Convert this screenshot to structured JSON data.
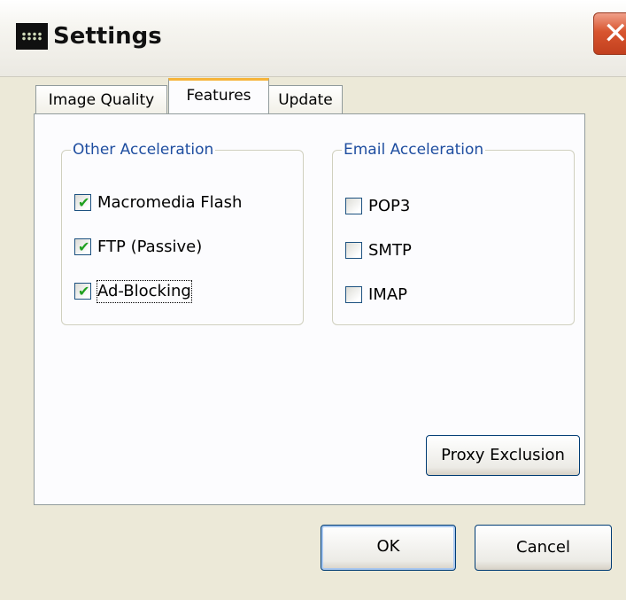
{
  "window": {
    "title": "Settings",
    "close_glyph": "✕"
  },
  "tabs": [
    {
      "label": "Image Quality",
      "active": false
    },
    {
      "label": "Features",
      "active": true
    },
    {
      "label": "Update",
      "active": false
    }
  ],
  "other_acceleration": {
    "legend": "Other Acceleration",
    "items": [
      {
        "label": "Macromedia Flash",
        "checked": true
      },
      {
        "label": "FTP (Passive)",
        "checked": true
      },
      {
        "label": "Ad-Blocking",
        "checked": true
      }
    ]
  },
  "email_acceleration": {
    "legend": "Email Acceleration",
    "items": [
      {
        "label": "POP3",
        "checked": false
      },
      {
        "label": "SMTP",
        "checked": false
      },
      {
        "label": "IMAP",
        "checked": false
      }
    ]
  },
  "buttons": {
    "proxy_exclusion": "Proxy Exclusion",
    "ok": "OK",
    "cancel": "Cancel"
  },
  "colors": {
    "legend": "#1f4ea0",
    "check": "#21a121",
    "active_tab_accent": "#f6b43a",
    "close_button": "#d8552f"
  },
  "icons": {
    "app": "app-icon",
    "close": "close-icon",
    "checkmark": "checkmark-icon"
  }
}
